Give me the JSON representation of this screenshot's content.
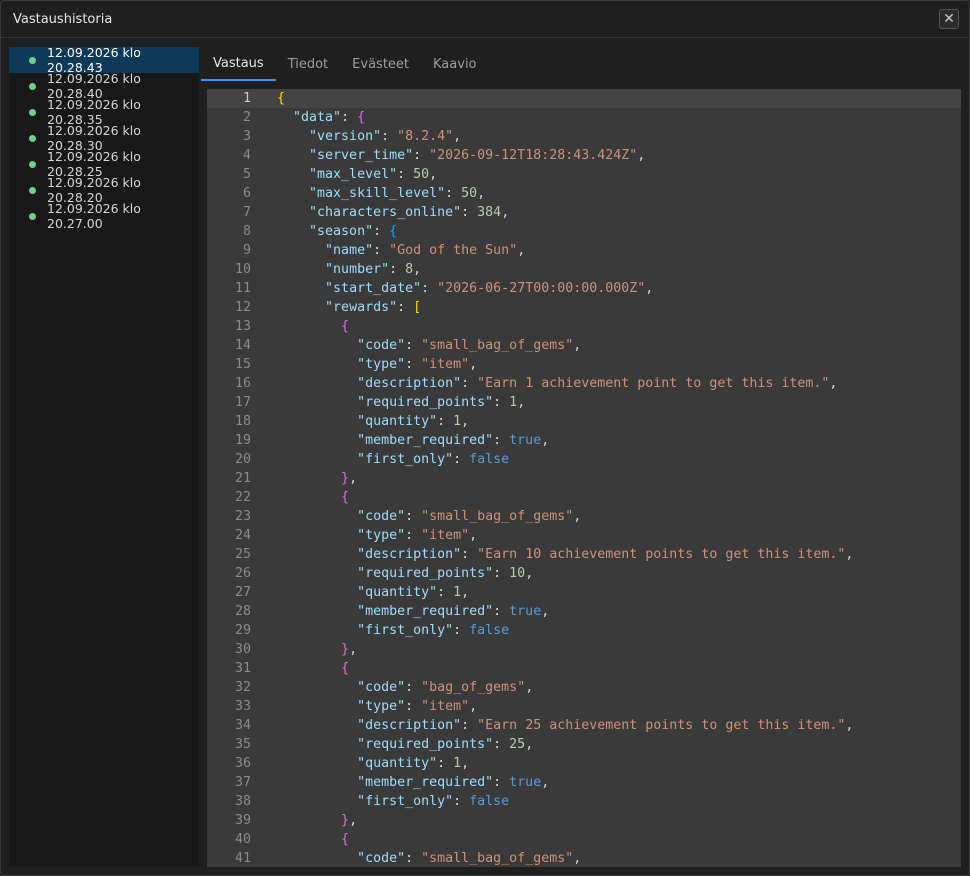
{
  "window": {
    "title": "Vastaushistoria",
    "close_label": "✕"
  },
  "history": [
    {
      "label": "12.09.2026 klo 20.28.43",
      "active": true
    },
    {
      "label": "12.09.2026 klo 20.28.40",
      "active": false
    },
    {
      "label": "12.09.2026 klo 20.28.35",
      "active": false
    },
    {
      "label": "12.09.2026 klo 20.28.30",
      "active": false
    },
    {
      "label": "12.09.2026 klo 20.28.25",
      "active": false
    },
    {
      "label": "12.09.2026 klo 20.28.20",
      "active": false
    },
    {
      "label": "12.09.2026 klo 20.27.00",
      "active": false
    }
  ],
  "tabs": [
    {
      "label": "Vastaus",
      "active": true
    },
    {
      "label": "Tiedot",
      "active": false
    },
    {
      "label": "Evästeet",
      "active": false
    },
    {
      "label": "Kaavio",
      "active": false
    }
  ],
  "colors": {
    "status_dot": "#6fcf8a",
    "active_history": "#0e3a5a",
    "tab_accent": "#3794ff"
  },
  "editor": {
    "current_line": 1,
    "lines": [
      "{",
      "  \"data\": {",
      "    \"version\": \"8.2.4\",",
      "    \"server_time\": \"2026-09-12T18:28:43.424Z\",",
      "    \"max_level\": 50,",
      "    \"max_skill_level\": 50,",
      "    \"characters_online\": 384,",
      "    \"season\": {",
      "      \"name\": \"God of the Sun\",",
      "      \"number\": 8,",
      "      \"start_date\": \"2026-06-27T00:00:00.000Z\",",
      "      \"rewards\": [",
      "        {",
      "          \"code\": \"small_bag_of_gems\",",
      "          \"type\": \"item\",",
      "          \"description\": \"Earn 1 achievement point to get this item.\",",
      "          \"required_points\": 1,",
      "          \"quantity\": 1,",
      "          \"member_required\": true,",
      "          \"first_only\": false",
      "        },",
      "        {",
      "          \"code\": \"small_bag_of_gems\",",
      "          \"type\": \"item\",",
      "          \"description\": \"Earn 10 achievement points to get this item.\",",
      "          \"required_points\": 10,",
      "          \"quantity\": 1,",
      "          \"member_required\": true,",
      "          \"first_only\": false",
      "        },",
      "        {",
      "          \"code\": \"bag_of_gems\",",
      "          \"type\": \"item\",",
      "          \"description\": \"Earn 25 achievement points to get this item.\",",
      "          \"required_points\": 25,",
      "          \"quantity\": 1,",
      "          \"member_required\": true,",
      "          \"first_only\": false",
      "        },",
      "        {",
      "          \"code\": \"small_bag_of_gems\","
    ]
  }
}
